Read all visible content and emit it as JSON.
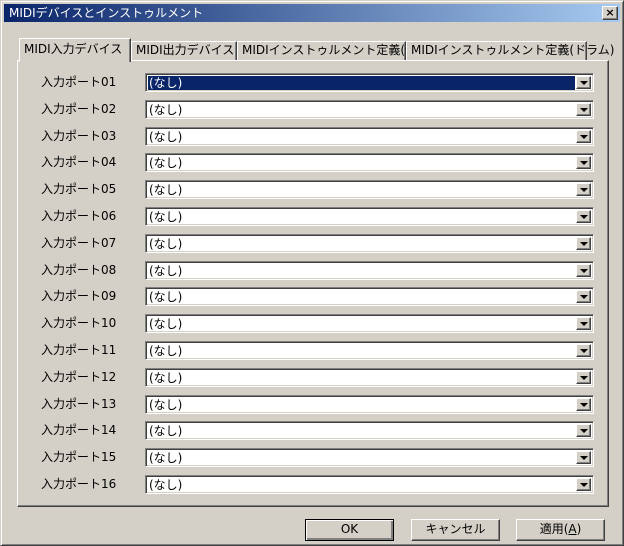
{
  "window": {
    "title": "MIDIデバイスとインストゥルメント",
    "close_label": "×"
  },
  "tabs": [
    {
      "label": "MIDI入力デバイス",
      "active": true
    },
    {
      "label": "MIDI出力デバイス",
      "active": false
    },
    {
      "label": "MIDIインストゥルメント定義(通常)",
      "active": false
    },
    {
      "label": "MIDIインストゥルメント定義(ドラム)",
      "active": false
    }
  ],
  "ports": [
    {
      "label": "入力ポート01",
      "value": "(なし)",
      "selected": true
    },
    {
      "label": "入力ポート02",
      "value": "(なし)"
    },
    {
      "label": "入力ポート03",
      "value": "(なし)"
    },
    {
      "label": "入力ポート04",
      "value": "(なし)"
    },
    {
      "label": "入力ポート05",
      "value": "(なし)"
    },
    {
      "label": "入力ポート06",
      "value": "(なし)"
    },
    {
      "label": "入力ポート07",
      "value": "(なし)"
    },
    {
      "label": "入力ポート08",
      "value": "(なし)"
    },
    {
      "label": "入力ポート09",
      "value": "(なし)"
    },
    {
      "label": "入力ポート10",
      "value": "(なし)"
    },
    {
      "label": "入力ポート11",
      "value": "(なし)"
    },
    {
      "label": "入力ポート12",
      "value": "(なし)"
    },
    {
      "label": "入力ポート13",
      "value": "(なし)"
    },
    {
      "label": "入力ポート14",
      "value": "(なし)"
    },
    {
      "label": "入力ポート15",
      "value": "(なし)"
    },
    {
      "label": "入力ポート16",
      "value": "(なし)"
    }
  ],
  "buttons": {
    "ok": "OK",
    "cancel": "キャンセル",
    "apply_prefix": "適用(",
    "apply_key": "A",
    "apply_suffix": ")"
  },
  "colors": {
    "face": "#d4d0c8",
    "title_start": "#0a246a",
    "title_end": "#a6caf0",
    "highlight": "#0a246a"
  }
}
